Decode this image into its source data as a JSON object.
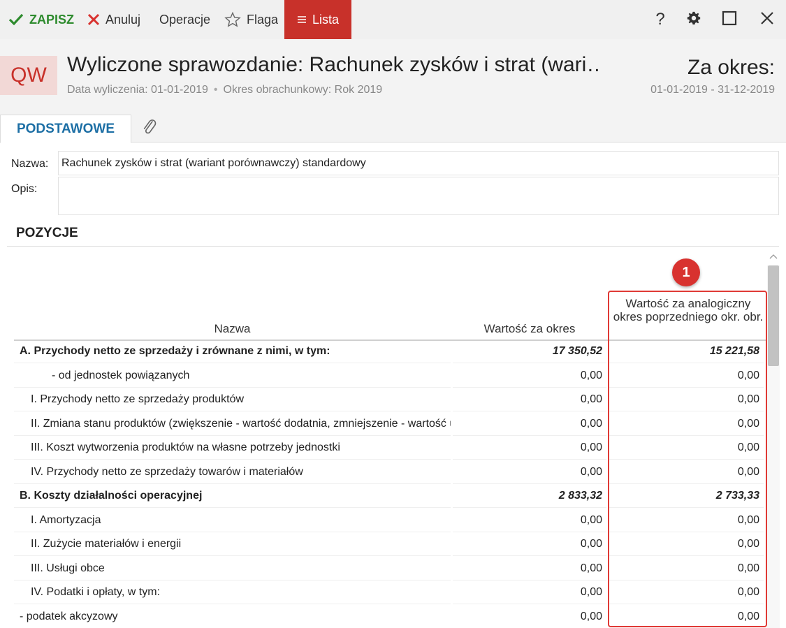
{
  "toolbar": {
    "save_label": "ZAPISZ",
    "cancel_label": "Anuluj",
    "operations_label": "Operacje",
    "flag_label": "Flaga",
    "list_label": "Lista",
    "help_label": "?"
  },
  "header": {
    "avatar": "QW",
    "title": "Wyliczone sprawozdanie: Rachunek zysków i strat (wari…",
    "calc_date": "Data wyliczenia: 01-01-2019",
    "accounting_period": "Okres obrachunkowy: Rok 2019",
    "separator": "•",
    "period_label": "Za okres:",
    "period_range": "01-01-2019 - 31-12-2019"
  },
  "tabs": {
    "basic": "PODSTAWOWE"
  },
  "form": {
    "name_label": "Nazwa:",
    "name_value": "Rachunek zysków i strat (wariant porównawczy) standardowy",
    "desc_label": "Opis:",
    "desc_value": ""
  },
  "section": {
    "title": "POZYCJE"
  },
  "table": {
    "col_name": "Nazwa",
    "col_value": "Wartość za okres",
    "col_prev": "Wartość za analogiczny okres poprzedniego okr. obr.",
    "rows": [
      {
        "name": "A. Przychody netto ze sprzedaży i zrównane z nimi, w tym:",
        "value": "17 350,52",
        "prev": "15 221,58",
        "bold": true,
        "indent": 0
      },
      {
        "name": "- od jednostek powiązanych",
        "value": "0,00",
        "prev": "0,00",
        "bold": false,
        "indent": 3
      },
      {
        "name": "I. Przychody netto ze sprzedaży produktów",
        "value": "0,00",
        "prev": "0,00",
        "bold": false,
        "indent": 2
      },
      {
        "name": "II. Zmiana stanu produktów (zwiększenie - wartość dodatnia, zmniejszenie - wartość ujemna)",
        "value": "0,00",
        "prev": "0,00",
        "bold": false,
        "indent": 2
      },
      {
        "name": "III. Koszt wytworzenia produktów na własne potrzeby jednostki",
        "value": "0,00",
        "prev": "0,00",
        "bold": false,
        "indent": 2
      },
      {
        "name": "IV. Przychody netto ze sprzedaży towarów i materiałów",
        "value": "0,00",
        "prev": "0,00",
        "bold": false,
        "indent": 2
      },
      {
        "name": "B. Koszty działalności operacyjnej",
        "value": "2 833,32",
        "prev": "2 733,33",
        "bold": true,
        "indent": 0
      },
      {
        "name": "I. Amortyzacja",
        "value": "0,00",
        "prev": "0,00",
        "bold": false,
        "indent": 2
      },
      {
        "name": "II. Zużycie materiałów i energii",
        "value": "0,00",
        "prev": "0,00",
        "bold": false,
        "indent": 2
      },
      {
        "name": "III. Usługi obce",
        "value": "0,00",
        "prev": "0,00",
        "bold": false,
        "indent": 2
      },
      {
        "name": "IV. Podatki i opłaty, w tym:",
        "value": "0,00",
        "prev": "0,00",
        "bold": false,
        "indent": 2
      },
      {
        "name": "- podatek akcyzowy",
        "value": "0,00",
        "prev": "0,00",
        "bold": false,
        "indent": 4
      }
    ]
  },
  "annotation": {
    "badge": "1"
  },
  "colors": {
    "accent_red": "#c8312a",
    "save_green": "#2e8b2e",
    "tab_blue": "#1d6fa5",
    "highlight_red": "#e03a36"
  }
}
